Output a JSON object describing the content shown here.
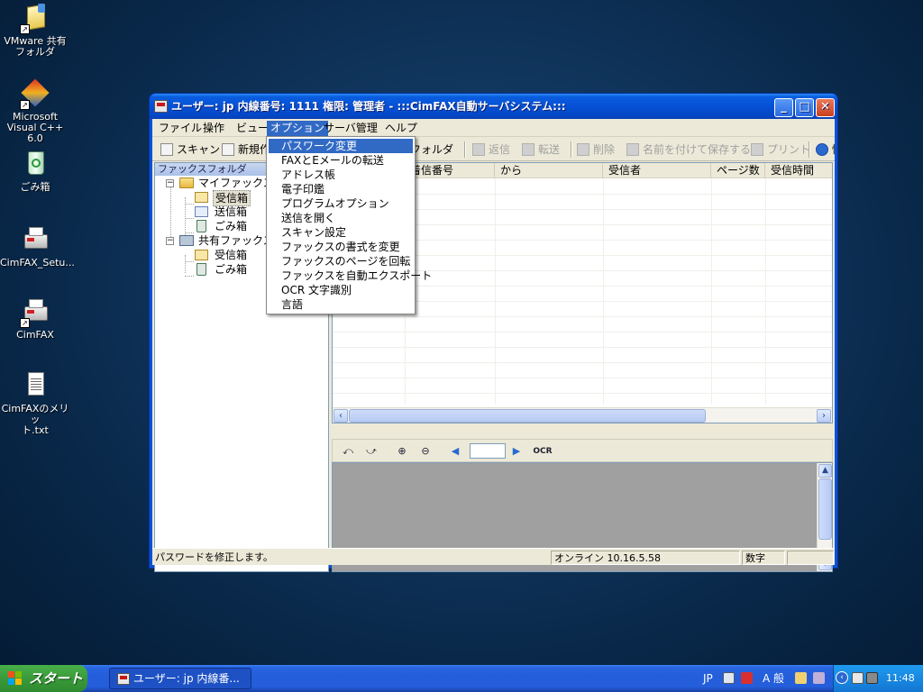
{
  "desktop": {
    "icons": [
      {
        "label_line1": "VMware 共有",
        "label_line2": "フォルダ"
      },
      {
        "label_line1": "Microsoft",
        "label_line2": "Visual C++ 6.0"
      },
      {
        "label_line1": "ごみ箱",
        "label_line2": ""
      },
      {
        "label_line1": "CimFAX_Setu...",
        "label_line2": ""
      },
      {
        "label_line1": "CimFAX",
        "label_line2": ""
      },
      {
        "label_line1": "CimFAXのメリッ",
        "label_line2": "ト.txt"
      }
    ]
  },
  "window": {
    "title": "ユーザー: jp  内線番号: 1111  権限: 管理者 - :::CimFAX自動サーバシステム:::",
    "minimize": "_",
    "maximize": "□",
    "close": "✕"
  },
  "menubar": {
    "items": [
      {
        "label": "ファイル"
      },
      {
        "label": "操作"
      },
      {
        "label": "ビュー"
      },
      {
        "label": "オプション"
      },
      {
        "label": "サーバ管理"
      },
      {
        "label": "ヘルプ"
      }
    ]
  },
  "toolbar": {
    "scan": "スキャン",
    "new": "新規作",
    "folder": "アフォルダ",
    "reply": "返信",
    "forward": "転送",
    "delete": "削除",
    "save_as": "名前を付けて保存する",
    "print": "プリント",
    "info": "情"
  },
  "tree": {
    "header": "ファックスフォルダ",
    "my_fax": "マイファックス",
    "inbox": "受信箱",
    "outbox": "送信箱",
    "trash": "ごみ箱",
    "shared_fax": "共有ファックス",
    "shared_inbox": "受信箱",
    "shared_trash": "ごみ箱"
  },
  "list": {
    "columns": [
      "",
      "着信番号",
      "から",
      "受信者",
      "ページ数",
      "受信時間"
    ]
  },
  "preview": {
    "ocr": "OCR",
    "page_value": ""
  },
  "options_menu": {
    "items": [
      "パスワーク変更",
      "FAXとEメールの転送",
      "アドレス帳",
      "電子印鑑",
      "プログラムオプション",
      "送信を開く",
      "スキャン設定",
      "ファックスの書式を変更",
      "ファックスのページを回転",
      "ファックスを自動エクスポート",
      "OCR 文字識別",
      "言語"
    ],
    "highlighted_index": 0
  },
  "statusbar": {
    "message": "パスワードを修正します。",
    "connection": "オンライン 10.16.5.58",
    "numlock": "数字"
  },
  "taskbar": {
    "start": "スタート",
    "task_label": "ユーザー: jp  内線番...",
    "lang": "JP",
    "ime_mode": "A 般",
    "clock": "11:48"
  },
  "colors": {
    "title_blue": "#0a52d8",
    "menu_highlight": "#316ac5",
    "taskbar_blue": "#245edb",
    "start_green": "#3a9a3a"
  }
}
